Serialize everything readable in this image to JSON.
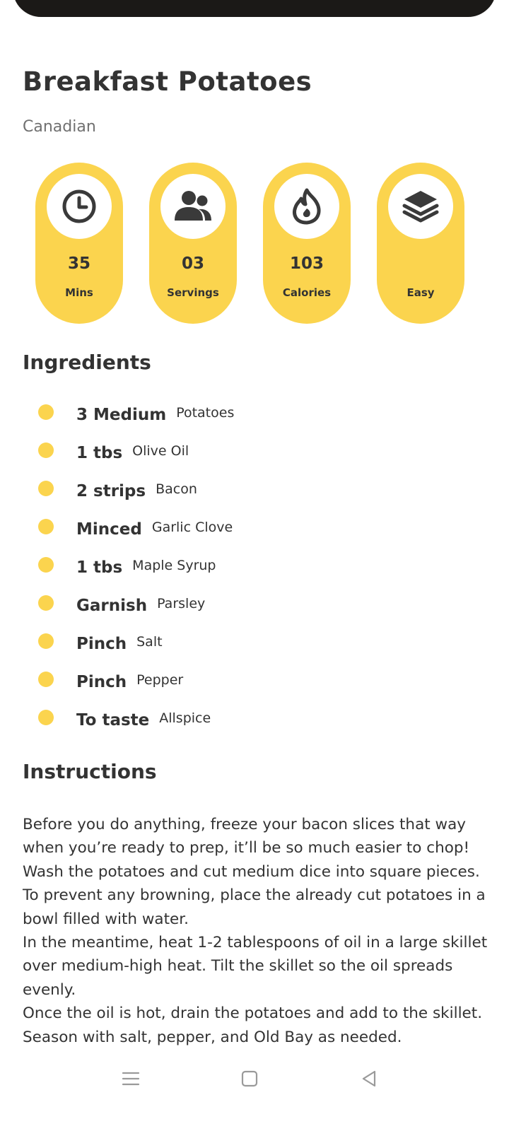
{
  "recipe": {
    "title": "Breakfast Potatoes",
    "cuisine": "Canadian"
  },
  "stats": [
    {
      "icon": "clock-icon",
      "value": "35",
      "label": "Mins"
    },
    {
      "icon": "people-icon",
      "value": "03",
      "label": "Servings"
    },
    {
      "icon": "flame-icon",
      "value": "103",
      "label": "Calories"
    },
    {
      "icon": "layers-icon",
      "value": "",
      "label": "Easy"
    }
  ],
  "ingredients": {
    "heading": "Ingredients",
    "items": [
      {
        "qty": "3 Medium",
        "name": "Potatoes"
      },
      {
        "qty": "1 tbs",
        "name": "Olive Oil"
      },
      {
        "qty": "2 strips",
        "name": "Bacon"
      },
      {
        "qty": "Minced",
        "name": "Garlic Clove"
      },
      {
        "qty": "1 tbs",
        "name": "Maple Syrup"
      },
      {
        "qty": "Garnish",
        "name": "Parsley"
      },
      {
        "qty": "Pinch",
        "name": "Salt"
      },
      {
        "qty": "Pinch",
        "name": "Pepper"
      },
      {
        "qty": "To taste",
        "name": "Allspice"
      }
    ]
  },
  "instructions": {
    "heading": "Instructions",
    "paragraphs": [
      "Before you do anything, freeze your bacon slices that way when you’re ready to prep, it’ll be so much easier to chop!",
      "Wash the potatoes and cut medium dice into square pieces. To prevent any browning, place the already cut potatoes in a bowl filled with water.",
      "In the meantime, heat 1-2 tablespoons of oil in a large skillet over medium-high heat. Tilt the skillet so the oil spreads evenly.",
      "Once the oil is hot, drain the potatoes and add to the skillet. Season with salt, pepper, and Old Bay as needed."
    ]
  },
  "colors": {
    "accent": "#fbd44e",
    "text": "#333333",
    "muted": "#707070"
  },
  "navbar": {
    "buttons": [
      "menu-icon",
      "home-square-icon",
      "back-triangle-icon"
    ]
  }
}
